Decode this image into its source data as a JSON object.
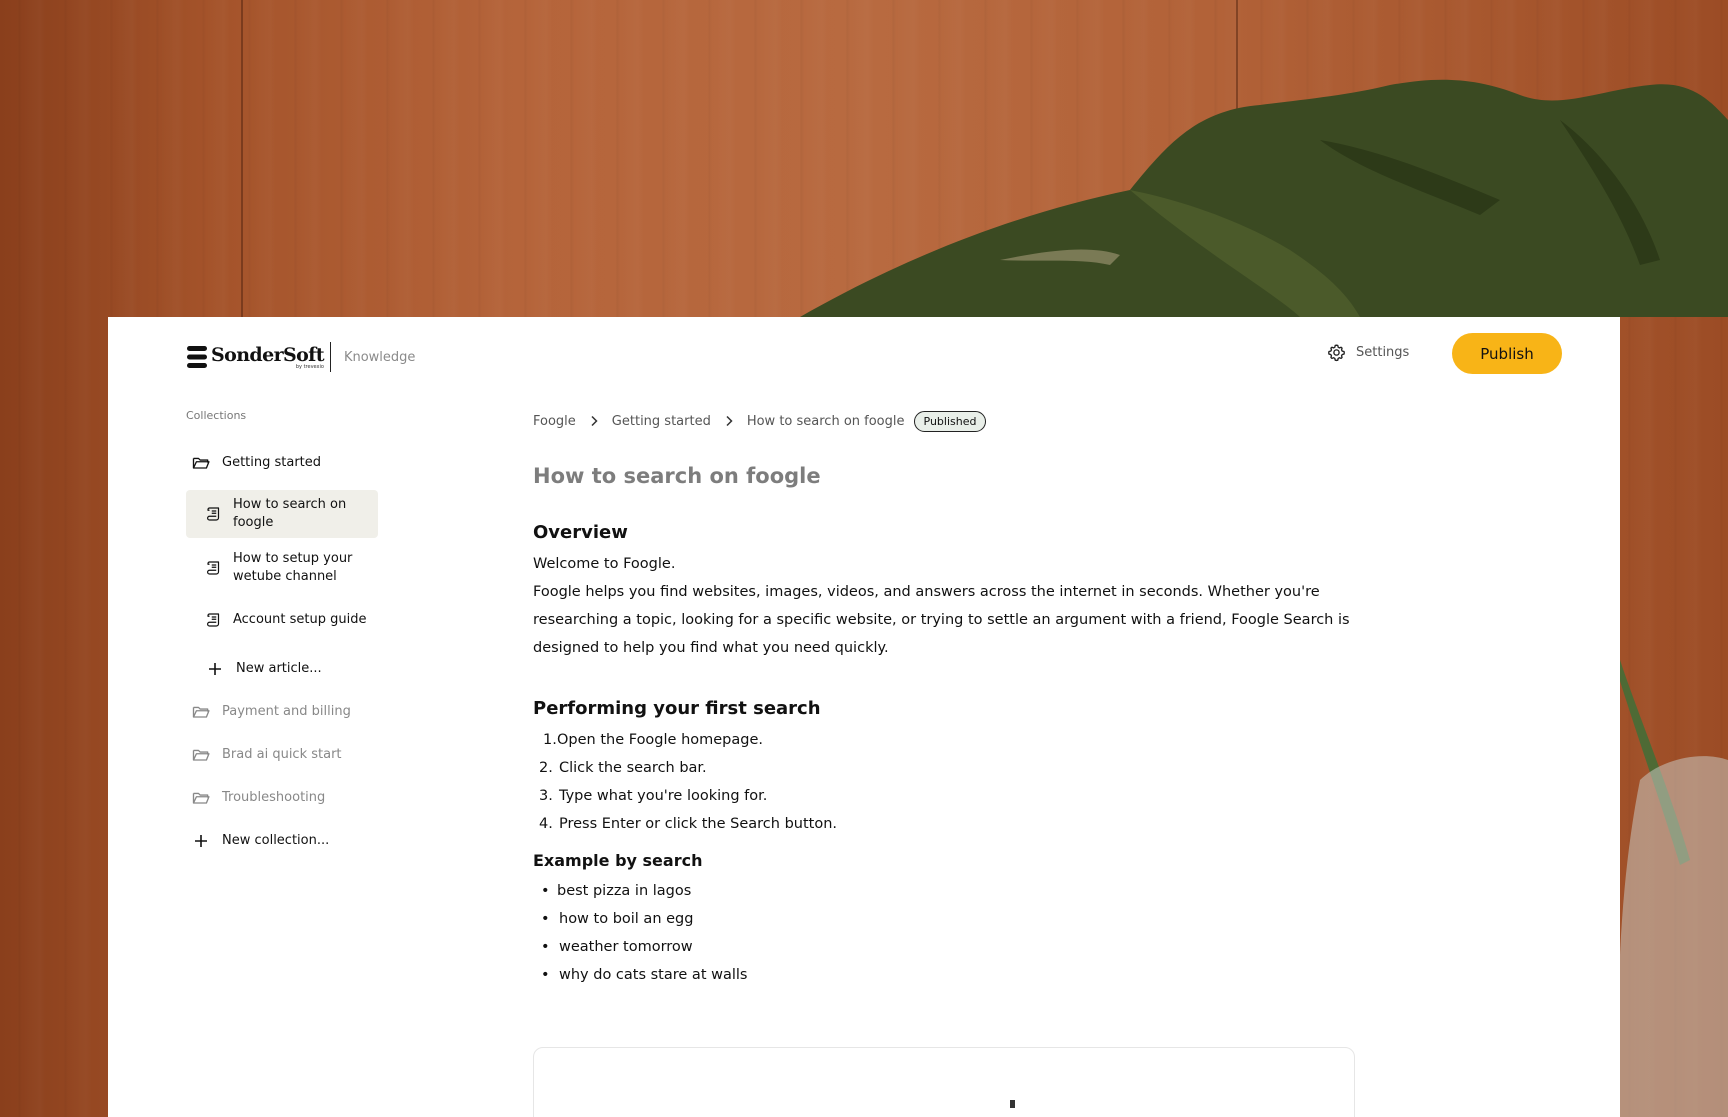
{
  "brand": {
    "name": "SonderSoft",
    "tagline": "by trevexio",
    "section": "Knowledge",
    "logo_icon": "stacked-stripes-logo-icon"
  },
  "header": {
    "settings_label": "Settings",
    "settings_icon": "gear-icon",
    "publish_label": "Publish",
    "publish_color": "#F8B417"
  },
  "sidebar": {
    "caption": "Collections",
    "active_collection": "Getting started",
    "articles": [
      {
        "label": "How to search on foogle",
        "selected": true
      },
      {
        "label": "How to setup your wetube channel",
        "selected": false
      },
      {
        "label": "Account setup guide",
        "selected": false
      }
    ],
    "new_article": "New article...",
    "collections": [
      "Payment and billing",
      "Brad ai quick start",
      "Troubleshooting"
    ],
    "new_collection": "New collection..."
  },
  "breadcrumb": {
    "items": [
      "Foogle",
      "Getting started",
      "How to search on foogle"
    ],
    "status": "Published"
  },
  "article": {
    "title": "How to search on foogle",
    "overview_heading": "Overview",
    "overview_lines": [
      "Welcome to Foogle.",
      "Foogle helps you find websites, images, videos, and answers across the internet in seconds. Whether you're researching a topic, looking for a specific website, or trying to settle an argument with a friend, Foogle Search is designed to help you find what you need quickly."
    ],
    "first_search_heading": "Performing your first search",
    "steps": [
      "Open the Foogle homepage.",
      "Click the search bar.",
      "Type what you're looking for.",
      "Press Enter or click the Search button."
    ],
    "examples_heading": "Example by search",
    "examples": [
      "best pizza in lagos",
      "how to boil an egg",
      "weather tomorrow",
      "why do cats stare at walls"
    ]
  }
}
